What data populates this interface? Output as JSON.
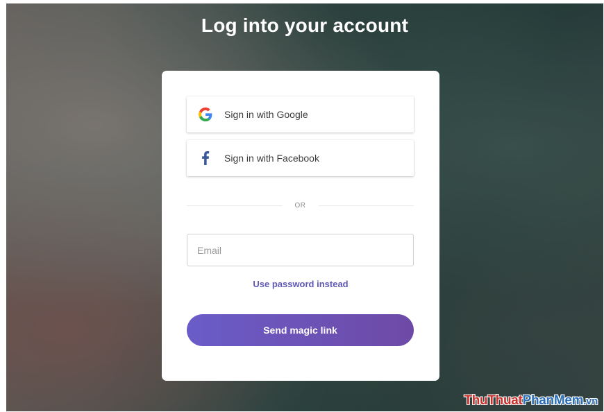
{
  "page": {
    "title": "Log into your account"
  },
  "social": {
    "google": {
      "label": "Sign in with Google",
      "icon": "google-icon"
    },
    "facebook": {
      "label": "Sign in with Facebook",
      "icon": "facebook-icon"
    }
  },
  "divider": {
    "text": "OR"
  },
  "email": {
    "placeholder": "Email",
    "value": ""
  },
  "links": {
    "use_password": "Use password instead"
  },
  "actions": {
    "send_magic_link": "Send magic link"
  },
  "watermark": {
    "part1": "ThuThuat",
    "part2": "PhanMem",
    "part3": ".vn"
  },
  "colors": {
    "accent": "#6a5cc8",
    "link": "#5f58b6",
    "facebook": "#3b5998"
  }
}
